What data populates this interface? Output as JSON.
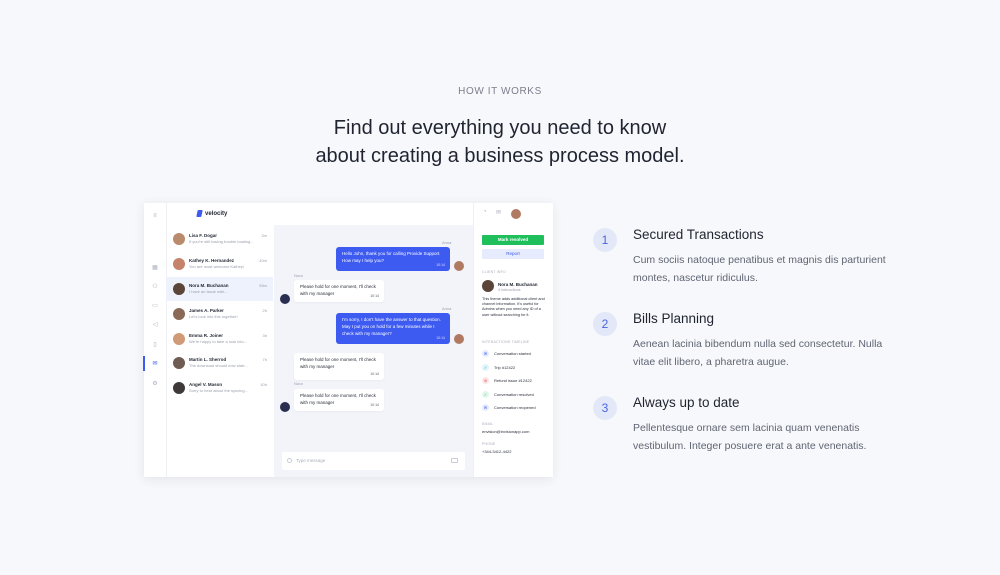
{
  "eyebrow": "HOW IT WORKS",
  "headline": {
    "line1": "Find out everything you need to know",
    "line2": "about creating a business process model."
  },
  "app": {
    "brand": "velocity",
    "conversations": [
      {
        "name": "Lisa F. Dogar",
        "preview": "If you're still having trouble loading...",
        "time": "2m",
        "avatar_color": "#b98b6c"
      },
      {
        "name": "Kathey K. Hernandez",
        "preview": "You are most welcome Kathey!",
        "time": "40m",
        "avatar_color": "#c4836a"
      },
      {
        "name": "Nora M. Buchanan",
        "preview": "I have an issue with...",
        "time": "59m",
        "avatar_color": "#5a4538"
      },
      {
        "name": "James A. Parker",
        "preview": "Let's look into this together!",
        "time": "2h",
        "avatar_color": "#8a6a57"
      },
      {
        "name": "Emma R. Joiner",
        "preview": "We're happy to take a look into...",
        "time": "3h",
        "avatar_color": "#d19a76"
      },
      {
        "name": "Martin L. Sherrod",
        "preview": "The download should now start...",
        "time": "7h",
        "avatar_color": "#6f5c52"
      },
      {
        "name": "Angel V. Mason",
        "preview": "Sorry to hear about the syncing...",
        "time": "10h",
        "avatar_color": "#3f3a3a"
      }
    ],
    "messages": [
      {
        "sender": "Anna",
        "text": "Hello John, thank you for calling Provide Support. How may I help you?",
        "time": "10:14"
      },
      {
        "sender": "Nora",
        "text": "Please hold for one moment, I'll check with my manager",
        "time": "10:14"
      },
      {
        "sender": "Anna",
        "text": "I'm sorry, I don't have the answer to that question. May I put you on hold for a few minutes while I check with my manager?",
        "time": "10:14"
      },
      {
        "sender": "",
        "text": "Please hold for one moment, I'll check with my manager",
        "time": "10:14"
      },
      {
        "sender": "Nora",
        "text": "Please hold for one moment, I'll check with my manager",
        "time": "10:14"
      }
    ],
    "composer_placeholder": "Type message",
    "panel": {
      "mark_resolved": "Mark resolved",
      "report": "Report",
      "client_info_label": "CLIENT INFO",
      "client_name": "Nora M. Buchanan",
      "client_interactions": "4 interactions",
      "client_desc": "This theme adds additional client and channel information. It's useful for Admins when you need any ID of a user without searching for it.",
      "timeline_label": "INTERACTIONS TIMELINE",
      "timeline": [
        {
          "label": "Conversation started",
          "color": "#3d5af1",
          "bg": "#e6ecfd",
          "icon": "✉"
        },
        {
          "label": "Trip #12422",
          "color": "#1fa4c9",
          "bg": "#e0f4fa",
          "icon": "✓"
        },
        {
          "label": "Refund issue #12422",
          "color": "#e0464f",
          "bg": "#fde6e7",
          "icon": "⊘"
        },
        {
          "label": "Conversation resolved",
          "color": "#1fbf5b",
          "bg": "#e2f7ea",
          "icon": "✓"
        },
        {
          "label": "Conversation reopened",
          "color": "#3d5af1",
          "bg": "#e6ecfd",
          "icon": "✉"
        }
      ],
      "email_label": "EMAIL",
      "email": "envision@invisionapp.com",
      "phone_label": "PHONE",
      "phone": "+344-3412-4422"
    }
  },
  "features": [
    {
      "number": "1",
      "title": "Secured Transactions",
      "desc": "Cum sociis natoque penatibus et magnis dis parturient montes, nascetur ridiculus."
    },
    {
      "number": "2",
      "title": "Bills Planning",
      "desc": "Aenean lacinia bibendum nulla sed consectetur. Nulla vitae elit libero, a pharetra augue."
    },
    {
      "number": "3",
      "title": "Always up to date",
      "desc": "Pellentesque ornare sem lacinia quam venenatis vestibulum. Integer posuere erat a ante venenatis."
    }
  ]
}
